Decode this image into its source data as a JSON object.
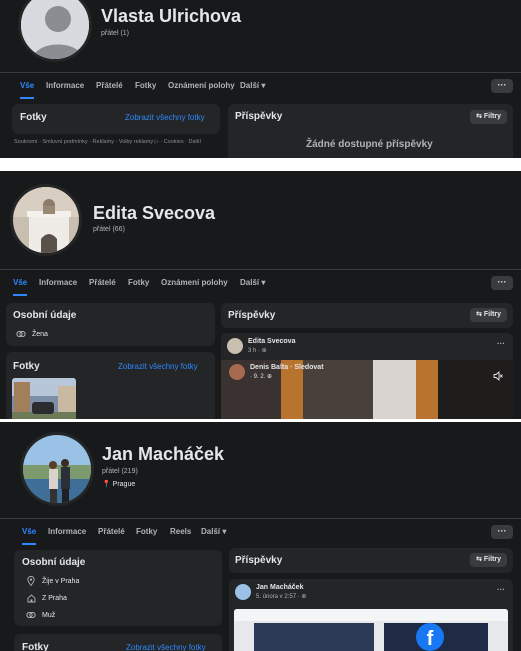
{
  "profiles": [
    {
      "name": "Vlasta Ulrichova",
      "friends": "přátel (1)",
      "tabs": [
        "Vše",
        "Informace",
        "Přátelé",
        "Fotky",
        "Oznámení polohy",
        "Další ▾"
      ],
      "more": "···",
      "photos_title": "Fotky",
      "photos_link": "Zobrazit všechny fotky",
      "posts_title": "Příspěvky",
      "filter": "⇆ Filtry",
      "footer": "Soukromí · Smluvní podmínky · Reklamy · Volby reklamy ▷ · Cookies · Další",
      "empty_posts": "Žádné dostupné příspěvky"
    },
    {
      "name": "Edita Svecova",
      "friends": "přátel (66)",
      "tabs": [
        "Vše",
        "Informace",
        "Přátelé",
        "Fotky",
        "Oznámení polohy",
        "Další ▾"
      ],
      "more": "···",
      "details_title": "Osobní údaje",
      "details": [
        {
          "icon": "gender-icon",
          "text": "Žena"
        }
      ],
      "photos_title": "Fotky",
      "photos_link": "Zobrazit všechny fotky",
      "posts_title": "Příspěvky",
      "filter": "⇆ Filtry",
      "post1_name": "Edita Svecova",
      "post1_meta": "3 h · ⊕",
      "post2_name": "Denis Balta · Sledovat",
      "post2_meta": "· 9. 2. ⊕",
      "dots": "···"
    },
    {
      "name": "Jan Macháček",
      "friends": "přátel (219)",
      "location": "📍 Prague",
      "tabs": [
        "Vše",
        "Informace",
        "Přátelé",
        "Fotky",
        "Reels",
        "Další ▾"
      ],
      "more": "···",
      "details_title": "Osobní údaje",
      "details": [
        {
          "icon": "location-icon",
          "text": "Žije v Praha"
        },
        {
          "icon": "home-icon",
          "text": "Z Praha"
        },
        {
          "icon": "gender-icon",
          "text": "Muž"
        }
      ],
      "photos_title": "Fotky",
      "photos_link": "Zobrazit všechny fotky",
      "posts_title": "Příspěvky",
      "filter": "⇆ Filtry",
      "post1_name": "Jan Macháček",
      "post1_meta": "5. února v 2:57 · ⊕",
      "dots": "···"
    }
  ],
  "colors": {
    "background": "#18191a",
    "card": "#242526",
    "accent": "#2d88ff",
    "text": "#e4e6eb",
    "muted": "#b0b3b8"
  }
}
